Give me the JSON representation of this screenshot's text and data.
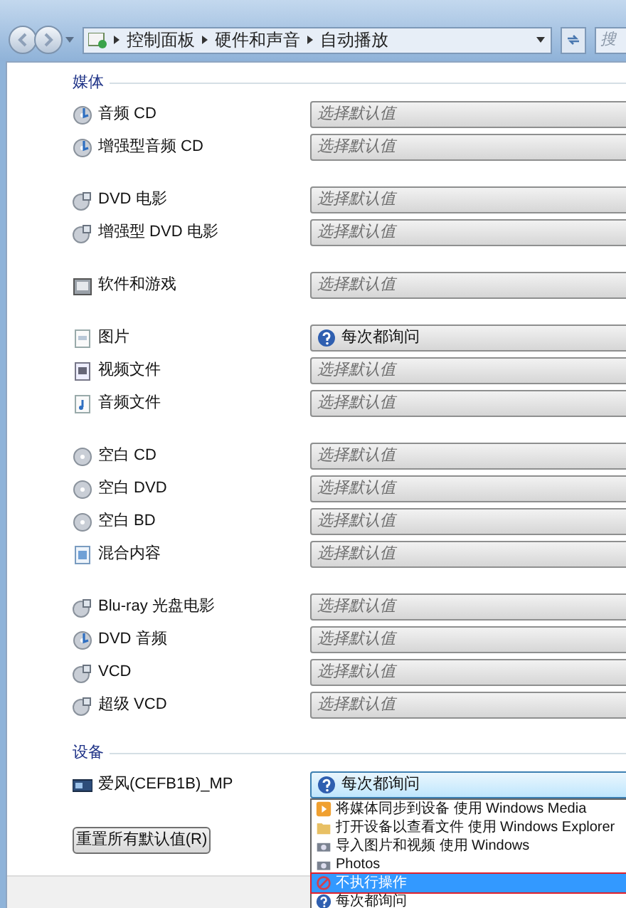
{
  "address_bar": {
    "breadcrumbs": [
      "控制面板",
      "硬件和声音",
      "自动播放"
    ]
  },
  "search": {
    "placeholder": "搜"
  },
  "sections": [
    {
      "title": "媒体",
      "groups": [
        [
          {
            "kind": "disc-audio",
            "label": "音频 CD",
            "combo": {
              "kind": "prompt",
              "value": "选择默认值"
            }
          },
          {
            "kind": "disc-audio",
            "label": "增强型音频 CD",
            "combo": {
              "kind": "prompt",
              "value": "选择默认值"
            }
          }
        ],
        [
          {
            "kind": "disc-video",
            "label": "DVD 电影",
            "combo": {
              "kind": "prompt",
              "value": "选择默认值"
            }
          },
          {
            "kind": "disc-video",
            "label": "增强型 DVD 电影",
            "combo": {
              "kind": "prompt",
              "value": "选择默认值"
            }
          }
        ],
        [
          {
            "kind": "software",
            "label": "软件和游戏",
            "combo": {
              "kind": "prompt",
              "value": "选择默认值"
            }
          }
        ],
        [
          {
            "kind": "picture",
            "label": "图片",
            "combo": {
              "kind": "ask",
              "value": "每次都询问"
            }
          },
          {
            "kind": "video-file",
            "label": "视频文件",
            "combo": {
              "kind": "prompt",
              "value": "选择默认值"
            }
          },
          {
            "kind": "audio-file",
            "label": "音频文件",
            "combo": {
              "kind": "prompt",
              "value": "选择默认值"
            }
          }
        ],
        [
          {
            "kind": "blank-disc",
            "label": "空白 CD",
            "combo": {
              "kind": "prompt",
              "value": "选择默认值"
            }
          },
          {
            "kind": "blank-disc",
            "label": "空白 DVD",
            "combo": {
              "kind": "prompt",
              "value": "选择默认值"
            }
          },
          {
            "kind": "blank-disc",
            "label": "空白 BD",
            "combo": {
              "kind": "prompt",
              "value": "选择默认值"
            }
          },
          {
            "kind": "mixed",
            "label": "混合内容",
            "combo": {
              "kind": "prompt",
              "value": "选择默认值"
            }
          }
        ],
        [
          {
            "kind": "disc-video",
            "label": "Blu-ray 光盘电影",
            "combo": {
              "kind": "prompt",
              "value": "选择默认值"
            }
          },
          {
            "kind": "disc-audio",
            "label": "DVD 音频",
            "combo": {
              "kind": "prompt",
              "value": "选择默认值"
            }
          },
          {
            "kind": "disc-video",
            "label": "VCD",
            "combo": {
              "kind": "prompt",
              "value": "选择默认值"
            }
          },
          {
            "kind": "disc-video",
            "label": "超级 VCD",
            "combo": {
              "kind": "prompt",
              "value": "选择默认值"
            }
          }
        ]
      ]
    },
    {
      "title": "设备",
      "groups": [
        [
          {
            "kind": "device",
            "label": "爱风(CEFB1B)_MP",
            "combo": {
              "kind": "ask",
              "value": "每次都询问",
              "expanded": true
            }
          }
        ]
      ]
    }
  ],
  "dropdown": [
    {
      "kind": "media",
      "label": "将媒体同步到设备 使用 Windows Media",
      "selected": false
    },
    {
      "kind": "folder",
      "label": "打开设备以查看文件 使用 Windows Explorer",
      "selected": false
    },
    {
      "kind": "camera",
      "label": "导入图片和视频 使用 Windows",
      "selected": false
    },
    {
      "kind": "camera",
      "label": "Photos",
      "selected": false
    },
    {
      "kind": "none",
      "label": "不执行操作",
      "selected": true
    },
    {
      "kind": "ask",
      "label": "每次都询问",
      "selected": false
    }
  ],
  "reset_button": "重置所有默认值(R)"
}
